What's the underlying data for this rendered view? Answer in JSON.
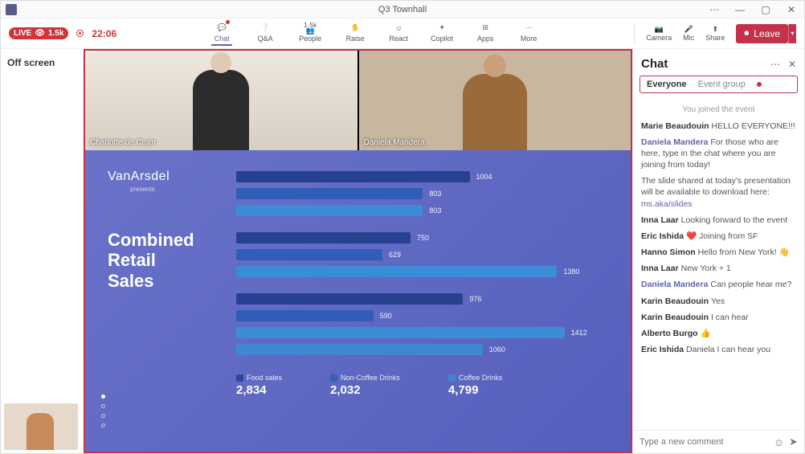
{
  "window": {
    "title": "Q3 Townhall"
  },
  "status": {
    "live": "LIVE",
    "viewers": "1.5k",
    "timer": "22:06"
  },
  "toolbar": {
    "chat": "Chat",
    "qna": "Q&A",
    "people": "People",
    "people_count": "1.5k",
    "raise": "Raise",
    "react": "React",
    "copilot": "Copilot",
    "apps": "Apps",
    "more": "More",
    "camera": "Camera",
    "mic": "Mic",
    "share": "Share",
    "leave": "Leave"
  },
  "offscreen": {
    "label": "Off screen"
  },
  "participants": {
    "p1": "Charlotte de Crum",
    "p2": "Daniela Mandera"
  },
  "slide": {
    "brand_a": "Van",
    "brand_b": "Arsdel",
    "presents": "presents",
    "headline1": "Combined",
    "headline2": "Retail",
    "headline3": "Sales"
  },
  "chart_data": {
    "type": "bar",
    "orientation": "horizontal",
    "groups": [
      {
        "food": 1004,
        "noncoffee": 803,
        "coffee": 803
      },
      {
        "food": 750,
        "noncoffee": 629,
        "coffee": 1380
      },
      {
        "food": 976,
        "noncoffee": 590,
        "coffee": 1412
      }
    ],
    "group3_extra": 1060,
    "legend": [
      {
        "label": "Food sales",
        "total": "2,834",
        "series": "food"
      },
      {
        "label": "Non-Coffee Drinks",
        "total": "2,032",
        "series": "noncoffee"
      },
      {
        "label": "Coffee Drinks",
        "total": "4,799",
        "series": "coffee"
      }
    ],
    "max_axis": 1600
  },
  "chat": {
    "title": "Chat",
    "tab_everyone": "Everyone",
    "tab_group": "Event group",
    "joined": "You joined the event",
    "messages": [
      {
        "author": "Marie Beaudouin",
        "text": "HELLO EVERYONE!!!",
        "host": false
      },
      {
        "author": "Daniela Mandera",
        "text": "For those who are here, type in the chat where you are joining from today!",
        "host": true
      },
      {
        "author": "",
        "text": "The slide shared at today's presentation will be available to download here: ",
        "link": "ms.aka/slides",
        "host": false,
        "system": true
      },
      {
        "author": "Inna Laar",
        "text": "Looking forward to the event",
        "host": false
      },
      {
        "author": "Eric Ishida",
        "text": "❤️  Joining from SF",
        "host": false
      },
      {
        "author": "Hanno Simon",
        "text": "Hello from New York!  👋",
        "host": false
      },
      {
        "author": "Inna Laar",
        "text": "New York + 1",
        "host": false
      },
      {
        "author": "Daniela Mandera",
        "text": "Can people hear me?",
        "host": true
      },
      {
        "author": "Karin Beaudouin",
        "text": "Yes",
        "host": false
      },
      {
        "author": "Karin Beaudouin",
        "text": "I can hear",
        "host": false
      },
      {
        "author": "Alberto Burgo",
        "text": "👍",
        "host": false
      },
      {
        "author": "Eric Ishida",
        "text": "Daniela I can hear you",
        "host": false
      }
    ],
    "compose_placeholder": "Type a new comment"
  }
}
